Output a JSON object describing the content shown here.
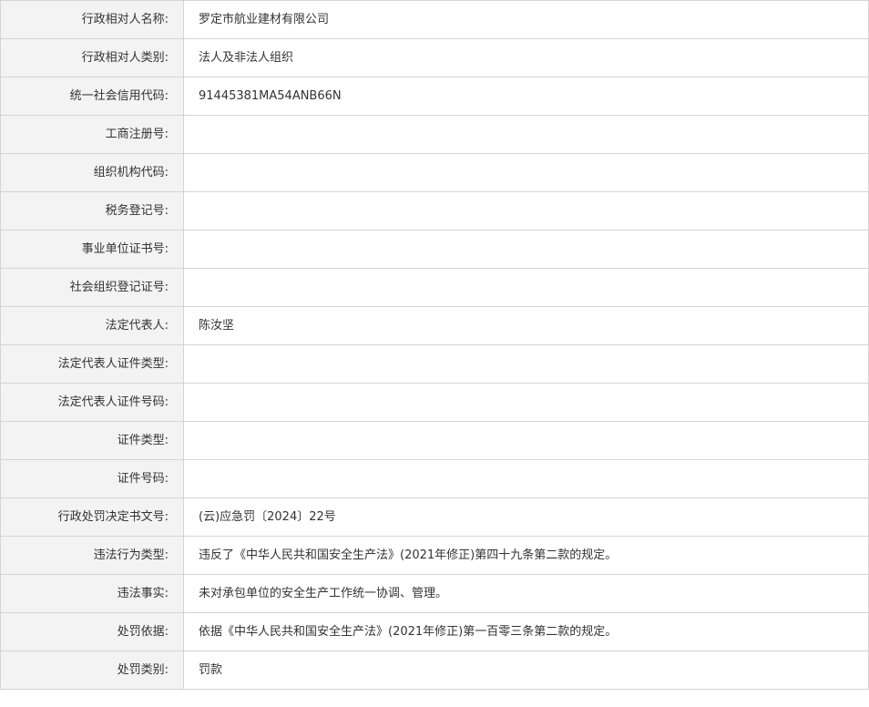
{
  "record": {
    "rows": [
      {
        "label": "行政相对人名称:",
        "value": "罗定市航业建材有限公司"
      },
      {
        "label": "行政相对人类别:",
        "value": "法人及非法人组织"
      },
      {
        "label": "统一社会信用代码:",
        "value": "91445381MA54ANB66N"
      },
      {
        "label": "工商注册号:",
        "value": ""
      },
      {
        "label": "组织机构代码:",
        "value": ""
      },
      {
        "label": "税务登记号:",
        "value": ""
      },
      {
        "label": "事业单位证书号:",
        "value": ""
      },
      {
        "label": "社会组织登记证号:",
        "value": ""
      },
      {
        "label": "法定代表人:",
        "value": "陈汝坚"
      },
      {
        "label": "法定代表人证件类型:",
        "value": ""
      },
      {
        "label": "法定代表人证件号码:",
        "value": ""
      },
      {
        "label": "证件类型:",
        "value": ""
      },
      {
        "label": "证件号码:",
        "value": ""
      },
      {
        "label": "行政处罚决定书文号:",
        "value": "(云)应急罚〔2024〕22号"
      },
      {
        "label": "违法行为类型:",
        "value": "违反了《中华人民共和国安全生产法》(2021年修正)第四十九条第二款的规定。"
      },
      {
        "label": "违法事实:",
        "value": "未对承包单位的安全生产工作统一协调、管理。"
      },
      {
        "label": "处罚依据:",
        "value": "依据《中华人民共和国安全生产法》(2021年修正)第一百零三条第二款的规定。"
      },
      {
        "label": "处罚类别:",
        "value": "罚款"
      }
    ]
  }
}
